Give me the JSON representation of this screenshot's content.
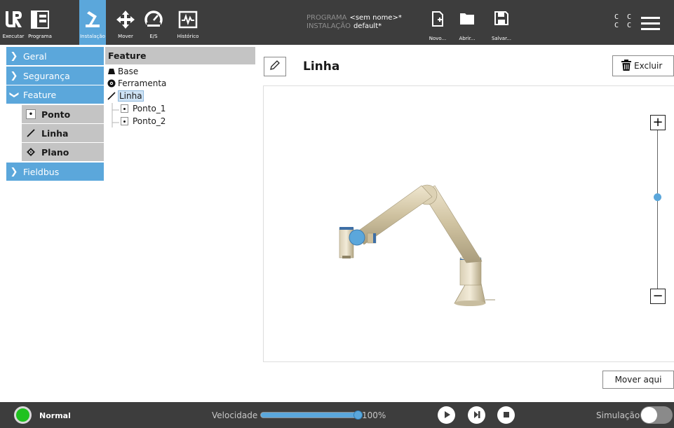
{
  "header": {
    "tabs": [
      {
        "label": "Executar",
        "icon": "ur-logo-icon"
      },
      {
        "label": "Programa",
        "icon": "program-tree-icon"
      },
      {
        "label": "Instalação",
        "icon": "robot-arm-icon",
        "active": true
      },
      {
        "label": "Mover",
        "icon": "move-arrows-icon"
      },
      {
        "label": "E/S",
        "icon": "io-gauge-icon"
      },
      {
        "label": "Histórico",
        "icon": "log-chart-icon"
      }
    ],
    "program_label": "PROGRAMA",
    "program_value": "<sem nome>*",
    "installation_label": "INSTALAÇÃO",
    "installation_value": "default*",
    "file_buttons": [
      {
        "label": "Novo...",
        "icon": "new-file-icon"
      },
      {
        "label": "Abrir...",
        "icon": "folder-icon"
      },
      {
        "label": "Salvar...",
        "icon": "save-icon"
      }
    ],
    "cc_top": "C C",
    "cc_bottom": "C C",
    "menu_icon": "hamburger-menu-icon"
  },
  "leftnav": {
    "items": [
      {
        "label": "Geral",
        "expanded": false
      },
      {
        "label": "Segurança",
        "expanded": false
      },
      {
        "label": "Feature",
        "expanded": true
      },
      {
        "label": "Fieldbus",
        "expanded": false
      }
    ],
    "subitems": [
      {
        "label": "Ponto",
        "icon": "point-icon"
      },
      {
        "label": "Linha",
        "icon": "line-icon"
      },
      {
        "label": "Plano",
        "icon": "plane-icon"
      }
    ]
  },
  "tree": {
    "header": "Feature",
    "nodes": [
      {
        "label": "Base",
        "icon": "base-icon"
      },
      {
        "label": "Ferramenta",
        "icon": "tool-icon"
      },
      {
        "label": "Linha",
        "icon": "line-icon",
        "selected": true
      },
      {
        "label": "Ponto_1",
        "icon": "point-icon"
      },
      {
        "label": "Ponto_2",
        "icon": "point-icon"
      }
    ]
  },
  "main": {
    "title": "Linha",
    "delete_label": "Excluir",
    "move_here_label": "Mover aqui",
    "zoom_plus": "+",
    "zoom_minus": "−",
    "zoom_level": 0.58
  },
  "footer": {
    "status": "Normal",
    "speed_label": "Velocidade",
    "speed_value": "100%",
    "speed_fraction": 1.0,
    "simulation_label": "Simulação",
    "simulation_on": false
  },
  "colors": {
    "accent": "#5ba7db",
    "header_bg": "#3d3d3d",
    "status_ok": "#1fc21f"
  }
}
